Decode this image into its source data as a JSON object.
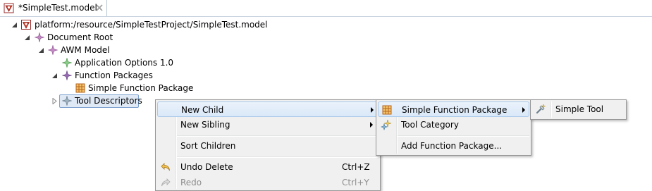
{
  "editor_tab": {
    "title": "*SimpleTest.model"
  },
  "tree": {
    "resource": "platform:/resource/SimpleTestProject/SimpleTest.model",
    "document_root": "Document Root",
    "awm_model": "AWM Model",
    "application_options": "Application Options 1.0",
    "function_packages": "Function Packages",
    "simple_function_package": "Simple Function Package",
    "tool_descriptors": "Tool Descriptors"
  },
  "context_menu": {
    "new_child": "New Child",
    "new_sibling": "New Sibling",
    "sort_children": "Sort Children",
    "undo_delete": "Undo Delete",
    "undo_shortcut": "Ctrl+Z",
    "redo": "Redo",
    "redo_shortcut": "Ctrl+Y"
  },
  "new_child_submenu": {
    "simple_function_package": "Simple Function Package",
    "tool_category": "Tool Category",
    "add_function_package": "Add Function Package..."
  },
  "simple_function_package_submenu": {
    "simple_tool": "Simple Tool"
  },
  "colors": {
    "selection_border": "#7da2ce",
    "selection_fill": "#dfe9f5",
    "menu_background": "#f0f0f0",
    "menu_highlight": "#dae8f8"
  }
}
